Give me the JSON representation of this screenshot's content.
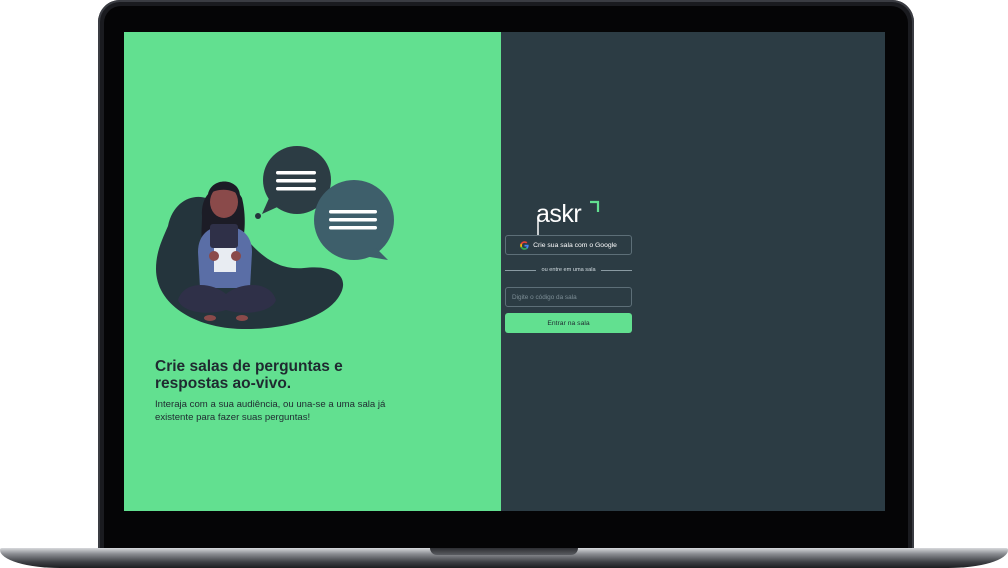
{
  "hero": {
    "title": "Crie salas de perguntas e respostas ao-vivo.",
    "subtitle": "Interaja com a sua audiência, ou una-se a uma sala já existente para fazer suas perguntas!"
  },
  "logo": {
    "text": "askr"
  },
  "auth": {
    "google_button_label": "Crie sua sala com o Google",
    "divider_text": "ou entre em uma sala",
    "room_code_placeholder": "Digite o código da sala",
    "enter_button_label": "Entrar na sala"
  },
  "colors": {
    "accent_green": "#62e090",
    "dark_panel": "#2c3c44",
    "speech_bubble_dark": "#2c3c44",
    "speech_bubble_teal": "#3e5f6b"
  },
  "icons": [
    "google-icon",
    "speech-bubble-icon"
  ]
}
